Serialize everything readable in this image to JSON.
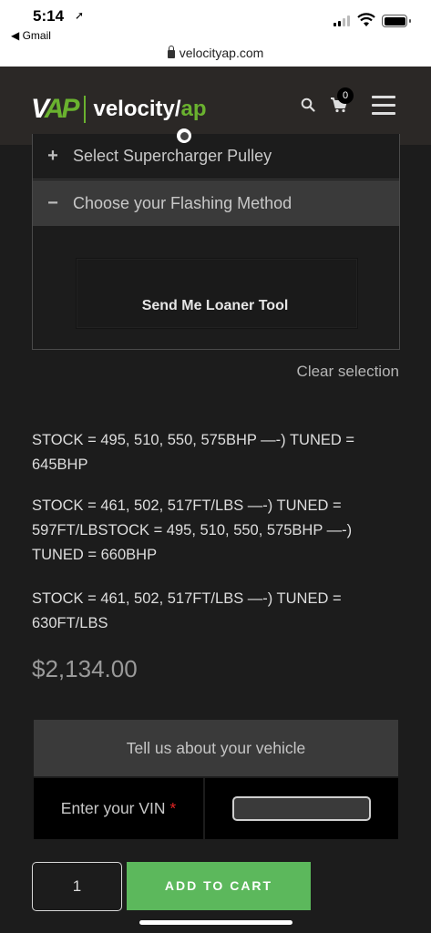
{
  "status_bar": {
    "time": "5:14",
    "back_app": "◀ Gmail"
  },
  "browser": {
    "url": "velocityap.com"
  },
  "header": {
    "logo_mark_v": "V",
    "logo_mark_ap": "AP",
    "logo_text_main": "velocity/",
    "logo_text_ap": "ap",
    "cart_count": "0",
    "icons": [
      "search-icon",
      "cart-icon",
      "hamburger-menu-icon"
    ]
  },
  "accordion": {
    "items": [
      {
        "symbol": "+",
        "label": "Select Supercharger Pulley"
      },
      {
        "symbol": "−",
        "label": "Choose your Flashing Method"
      }
    ],
    "selected_option": "Send Me Loaner Tool"
  },
  "clear_selection": "Clear selection",
  "descriptions": [
    "STOCK = 495, 510, 550, 575BHP —-) TUNED = 645BHP",
    "STOCK = 461, 502, 517FT/LBS —-) TUNED = 597FT/LBSTOCK = 495, 510, 550, 575BHP —-) TUNED = 660BHP",
    "STOCK = 461, 502, 517FT/LBS —-) TUNED = 630FT/LBS"
  ],
  "price": "$2,134.00",
  "vehicle_form": {
    "heading": "Tell us about your vehicle",
    "vin_label": "Enter your VIN",
    "required_mark": "*",
    "vin_value": ""
  },
  "purchase": {
    "quantity": "1",
    "add_to_cart": "ADD TO CART"
  },
  "colors": {
    "accent_green": "#5cb85c",
    "header_bg": "#2b2826",
    "page_bg": "#1c1c1c",
    "required_red": "#e02424"
  }
}
